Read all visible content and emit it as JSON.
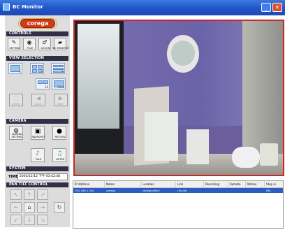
{
  "window": {
    "title": "BC Monitor",
    "minimize": "_",
    "close": "✕"
  },
  "brand": {
    "logo_text": "corega"
  },
  "controls": {
    "header": "CONTROLS",
    "buttons": [
      {
        "label": "SETTING",
        "icon": "✎"
      },
      {
        "label": "PLAY",
        "icon": "◉"
      },
      {
        "label": "LOGON",
        "icon": "♂"
      },
      {
        "label": "BC MONITOR",
        "icon": "▰"
      }
    ]
  },
  "view_selection": {
    "header": "VIEW SELECTION",
    "numbers": [
      "1",
      "4",
      "9",
      "16",
      "FULL"
    ],
    "nav_buttons": [
      {
        "label": "ZOOM",
        "icon": "⬚"
      },
      {
        "label": "BACK",
        "icon": "◀"
      },
      {
        "label": "NEXT",
        "icon": "▶"
      }
    ]
  },
  "camera": {
    "header": "CAMERA",
    "buttons": [
      {
        "label": "CAMERA SETTING",
        "icon": "⚙"
      },
      {
        "label": "SNAPSHOT",
        "icon": "▣"
      },
      {
        "label": "RECORD",
        "icon": "●"
      },
      {
        "label": "TALK",
        "icon": "♪"
      },
      {
        "label": "LISTEN",
        "icon": "♫"
      }
    ]
  },
  "system": {
    "header": "SYSTEM",
    "time_label": "TIME",
    "time_value": "2003/12/12 下午 03:42:48"
  },
  "pan_tilt": {
    "header": "PAN TILT CONTROL",
    "buttons": [
      "↖",
      "↑",
      "↗",
      "←",
      "⌂",
      "→",
      "↙",
      "↓",
      "↘"
    ],
    "reset_icon": "↻"
  },
  "devices_table": {
    "columns": [
      "IP Address",
      "Name",
      "Location",
      "Link",
      "Recording",
      "Remote",
      "Motion",
      "Stop in"
    ],
    "rows": [
      [
        "192.168.1.240",
        "corega",
        "corega office",
        "OnLink",
        "",
        "",
        "",
        "NEL"
      ]
    ]
  }
}
